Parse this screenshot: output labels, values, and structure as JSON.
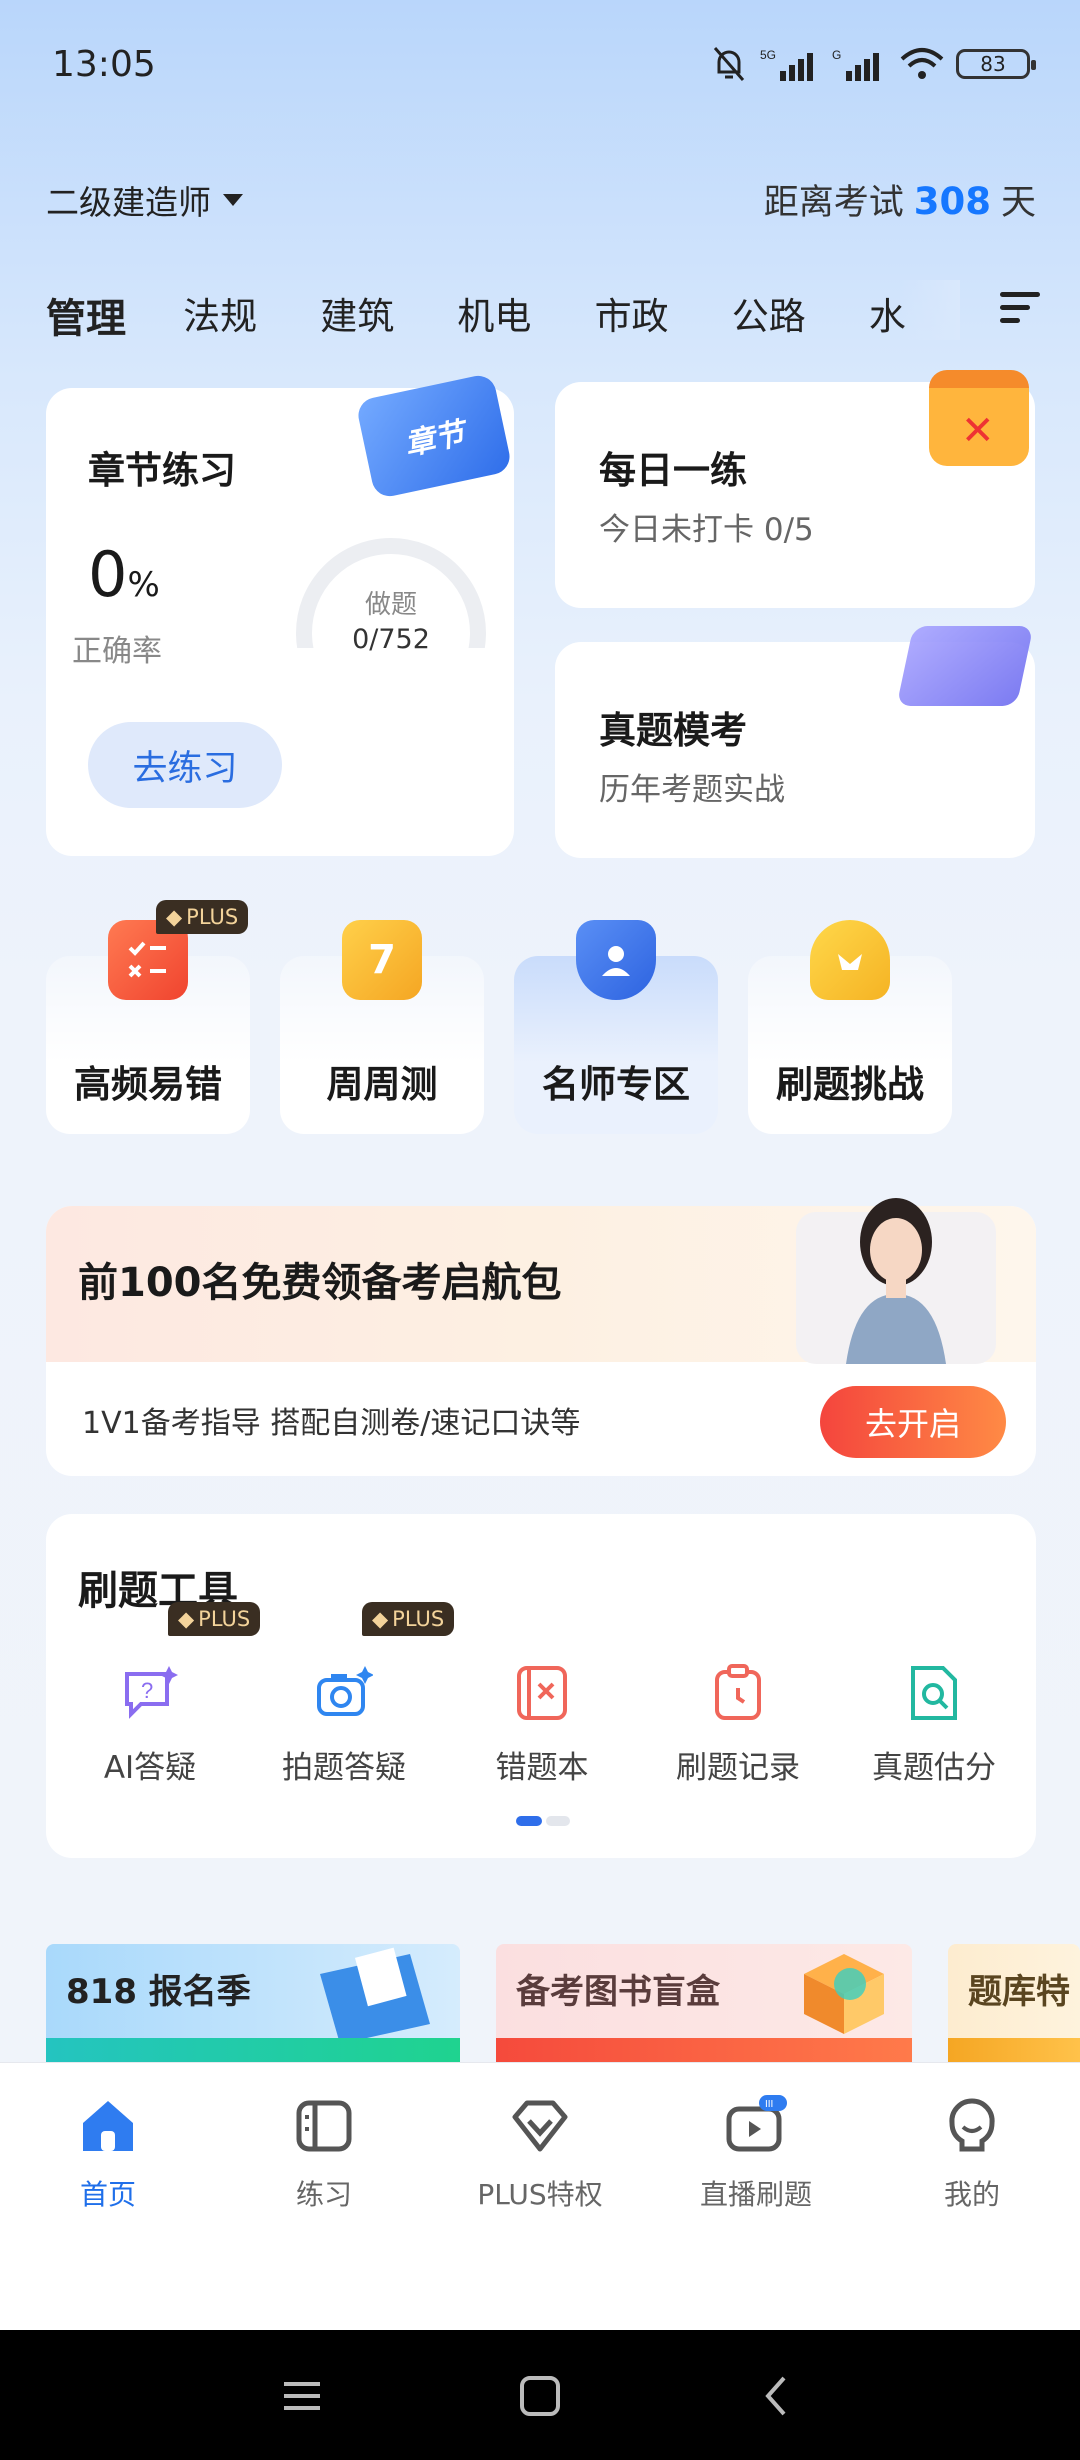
{
  "status": {
    "time": "13:05",
    "network": "5G",
    "battery": "83"
  },
  "header": {
    "exam": "二级建造师",
    "countdown_prefix": "距离考试",
    "countdown_days": "308",
    "countdown_unit": "天"
  },
  "tabs": [
    "管理",
    "法规",
    "建筑",
    "机电",
    "市政",
    "公路",
    "水"
  ],
  "chapter": {
    "title": "章节练习",
    "tag": "章节",
    "accuracy": "0",
    "accuracy_unit": "%",
    "accuracy_label": "正确率",
    "done_label": "做题",
    "done_value": "0/752",
    "button": "去练习"
  },
  "daily": {
    "title": "每日一练",
    "subtitle": "今日未打卡 0/5"
  },
  "real": {
    "title": "真题模考",
    "subtitle": "历年考题实战"
  },
  "quick": [
    {
      "label": "高频易错",
      "badge": "PLUS"
    },
    {
      "label": "周周测",
      "badge": "",
      "icon_text": "7"
    },
    {
      "label": "名师专区",
      "badge": ""
    },
    {
      "label": "刷题挑战",
      "badge": ""
    }
  ],
  "banner": {
    "title": "前100名免费领备考启航包",
    "subtitle": "1V1备考指导 搭配自测卷/速记口诀等",
    "button": "去开启"
  },
  "tools": {
    "title": "刷题工具",
    "items": [
      {
        "label": "AI答疑",
        "badge": "PLUS",
        "color": "#8a6df0"
      },
      {
        "label": "拍题答疑",
        "badge": "PLUS",
        "color": "#2f86f0"
      },
      {
        "label": "错题本",
        "badge": "",
        "color": "#f0665a"
      },
      {
        "label": "刷题记录",
        "badge": "",
        "color": "#f0665a"
      },
      {
        "label": "真题估分",
        "badge": "",
        "color": "#22b8a0"
      }
    ]
  },
  "promos": [
    "818 报名季",
    "备考图书盲盒",
    "题库特"
  ],
  "nav": [
    {
      "label": "首页",
      "active": true
    },
    {
      "label": "练习",
      "active": false
    },
    {
      "label": "PLUS特权",
      "active": false
    },
    {
      "label": "直播刷题",
      "active": false
    },
    {
      "label": "我的",
      "active": false
    }
  ],
  "colors": {
    "accent": "#1677ff",
    "nav_active": "#1f6fea"
  }
}
